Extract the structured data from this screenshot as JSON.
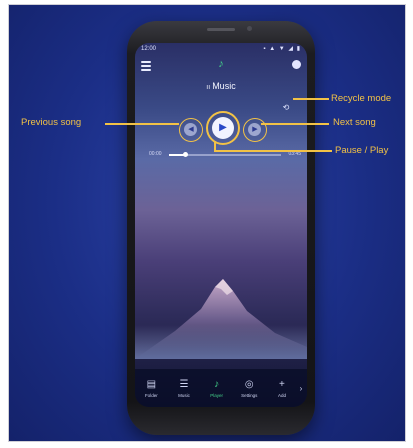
{
  "app": {
    "title": "Music"
  },
  "statusbar": {
    "time": "12:00",
    "icons": "▪ ▲ ▼ ◢ ▮"
  },
  "player": {
    "elapsed": "00:00",
    "total": "03:45",
    "progress_fraction": 0.15
  },
  "icons": {
    "menu": "menu-icon",
    "logo": "music-note-icon",
    "settings": "settings-icon",
    "recycle": "recycle-icon",
    "prev": "previous-icon",
    "play": "play-icon",
    "next": "next-icon"
  },
  "nav": {
    "items": [
      {
        "label": "Folder",
        "icon": "folder-icon"
      },
      {
        "label": "Music",
        "icon": "list-icon"
      },
      {
        "label": "Player",
        "icon": "note-icon",
        "active": true
      },
      {
        "label": "Settings",
        "icon": "dial-icon"
      },
      {
        "label": "Add",
        "icon": "plus-icon"
      }
    ]
  },
  "annotations": {
    "previous_song": "Previous song",
    "recycle_mode": "Recycle mode",
    "next_song": "Next song",
    "pause_play": "Pause / Play"
  },
  "colors": {
    "background": "#1b2e86",
    "callout": "#f2c246",
    "accent": "#43d18a"
  }
}
